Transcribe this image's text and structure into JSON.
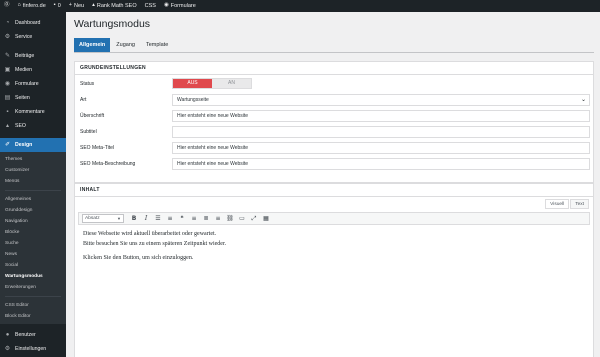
{
  "adminbar": {
    "site_name": "finfero.de",
    "comments_count": "0",
    "new_label": "Neu",
    "seo_label": "Rank Math SEO",
    "css_label": "CSS",
    "forms_label": "Formulare"
  },
  "menu": {
    "dashboard": "Dashboard",
    "service": "Service",
    "posts": "Beiträge",
    "media": "Medien",
    "forms": "Formulare",
    "pages": "Seiten",
    "comments": "Kommentare",
    "seo": "SEO",
    "design": "Design",
    "sub": [
      "Themes",
      "Customizer",
      "Menüs",
      "Allgemeines",
      "Grunddesign",
      "Navigation",
      "Blöcke",
      "Suche",
      "News",
      "Social",
      "Wartungsmodus",
      "Erweiterungen",
      "CSS Editor",
      "Block Editor"
    ],
    "users": "Benutzer",
    "settings": "Einstellungen"
  },
  "page": {
    "title": "Wartungsmodus",
    "tabs": [
      "Allgemein",
      "Zugang",
      "Template"
    ]
  },
  "basics": {
    "heading": "GRUNDEINSTELLUNGEN",
    "status_label": "Status",
    "status_off": "AUS",
    "status_on": "AN",
    "type_label": "Art",
    "type_value": "Wartungsseite",
    "heading_label": "Überschrift",
    "heading_value": "Hier entsteht eine neue Website",
    "subtitle_label": "Subtitel",
    "subtitle_value": "",
    "meta_title_label": "SEO Meta-Titel",
    "meta_title_value": "Hier entsteht eine neue Website",
    "meta_desc_label": "SEO Meta-Beschreibung",
    "meta_desc_value": "Hier entsteht eine neue Website"
  },
  "content": {
    "heading": "INHALT",
    "tab_visual": "Visuell",
    "tab_text": "Text",
    "format": "Absatz",
    "line1": "Diese Webseite wird aktuell überarbeitet oder gewartet.",
    "line2": "Bitte besuchen Sie uns zu einem späteren Zeitpunkt wieder.",
    "line3": "Klicken Sie den Button, um sich einzuloggen."
  },
  "colors": {
    "accent": "#2271b1",
    "sidebar": "#1d2327",
    "toggle_off": "#e0494d"
  }
}
